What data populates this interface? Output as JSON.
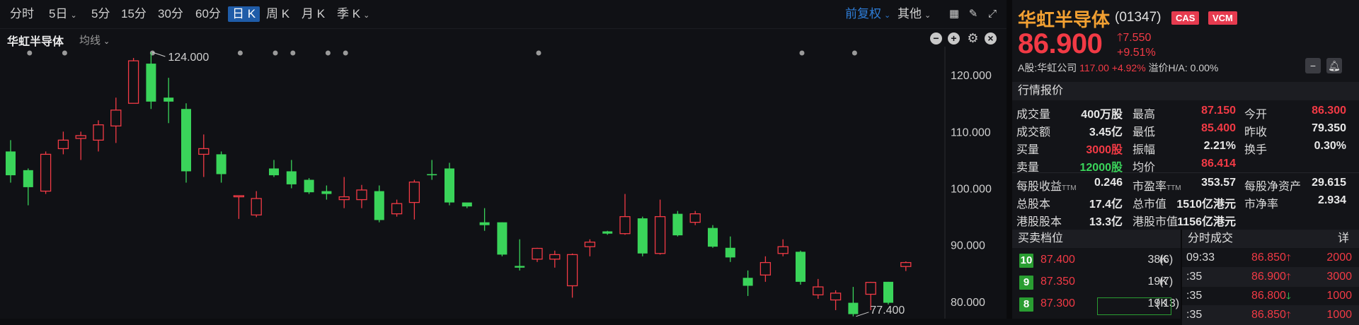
{
  "toolbar": {
    "periods": [
      {
        "label": "分时",
        "caret": false,
        "active": false
      },
      {
        "label": "5日",
        "caret": true,
        "active": false
      },
      {
        "label": "5分",
        "caret": false,
        "active": false
      },
      {
        "label": "15分",
        "caret": false,
        "active": false
      },
      {
        "label": "30分",
        "caret": false,
        "active": false
      },
      {
        "label": "60分",
        "caret": false,
        "active": false
      },
      {
        "label": "日 K",
        "caret": false,
        "active": true
      },
      {
        "label": "周 K",
        "caret": false,
        "active": false
      },
      {
        "label": "月 K",
        "caret": false,
        "active": false
      },
      {
        "label": "季 K",
        "caret": true,
        "active": false
      }
    ],
    "adjust": "前复权",
    "other": "其他",
    "icons": [
      "grid-icon",
      "draw-pen-icon",
      "fullscreen-icon"
    ]
  },
  "subbar": {
    "stock_name": "华虹半导体",
    "ma_label": "均线",
    "icons": [
      "zoom-out-icon",
      "zoom-in-icon",
      "settings-icon",
      "close-icon"
    ]
  },
  "chart_data": {
    "type": "candlestick",
    "y_ticks": [
      "120.000",
      "110.000",
      "100.000",
      "90.000",
      "80.000"
    ],
    "ylim": [
      77,
      125
    ],
    "high_label": "124.000",
    "low_label": "77.400",
    "up_color": "#f23a45",
    "down_color": "#3ad45a",
    "candles": [
      {
        "o": 106.5,
        "c": 102.3,
        "h": 108.5,
        "l": 101.0
      },
      {
        "o": 103.2,
        "c": 100.2,
        "h": 103.5,
        "l": 97.0
      },
      {
        "o": 99.5,
        "c": 106.0,
        "h": 106.5,
        "l": 99.0
      },
      {
        "o": 107.0,
        "c": 108.5,
        "h": 110.0,
        "l": 106.0
      },
      {
        "o": 108.8,
        "c": 109.3,
        "h": 110.0,
        "l": 105.0
      },
      {
        "o": 108.5,
        "c": 111.2,
        "h": 112.0,
        "l": 106.5
      },
      {
        "o": 111.0,
        "c": 113.8,
        "h": 116.0,
        "l": 108.0
      },
      {
        "o": 115.0,
        "c": 122.5,
        "h": 123.0,
        "l": 115.0
      },
      {
        "o": 122.0,
        "c": 115.3,
        "h": 124.0,
        "l": 114.0
      },
      {
        "o": 116.0,
        "c": 115.3,
        "h": 119.5,
        "l": 111.5
      },
      {
        "o": 114.0,
        "c": 103.0,
        "h": 115.0,
        "l": 101.0
      },
      {
        "o": 106.0,
        "c": 107.0,
        "h": 109.5,
        "l": 102.0
      },
      {
        "o": 106.0,
        "c": 102.5,
        "h": 106.5,
        "l": 101.0
      },
      {
        "o": 98.5,
        "c": 98.7,
        "h": 98.7,
        "l": 94.6
      },
      {
        "o": 95.3,
        "c": 98.2,
        "h": 99.5,
        "l": 94.9
      },
      {
        "o": 103.5,
        "c": 102.3,
        "h": 105.0,
        "l": 102.0
      },
      {
        "o": 103.0,
        "c": 100.7,
        "h": 105.0,
        "l": 100.0
      },
      {
        "o": 101.5,
        "c": 99.3,
        "h": 101.8,
        "l": 99.0
      },
      {
        "o": 99.5,
        "c": 99.0,
        "h": 100.5,
        "l": 98.0
      },
      {
        "o": 98.0,
        "c": 98.5,
        "h": 102.0,
        "l": 96.5
      },
      {
        "o": 98.0,
        "c": 99.7,
        "h": 100.6,
        "l": 96.5
      },
      {
        "o": 99.5,
        "c": 94.4,
        "h": 100.5,
        "l": 94.0
      },
      {
        "o": 95.5,
        "c": 97.3,
        "h": 98.0,
        "l": 95.0
      },
      {
        "o": 97.5,
        "c": 101.1,
        "h": 101.5,
        "l": 94.5
      },
      {
        "o": 102.5,
        "c": 102.3,
        "h": 105.0,
        "l": 101.5
      },
      {
        "o": 103.5,
        "c": 97.5,
        "h": 104.5,
        "l": 97.0
      },
      {
        "o": 97.5,
        "c": 96.8,
        "h": 97.0,
        "l": 96.5
      },
      {
        "o": 94.0,
        "c": 93.5,
        "h": 96.5,
        "l": 92.5
      },
      {
        "o": 94.0,
        "c": 88.3,
        "h": 94.0,
        "l": 88.0
      },
      {
        "o": 86.3,
        "c": 86.0,
        "h": 91.0,
        "l": 85.5
      },
      {
        "o": 87.5,
        "c": 89.4,
        "h": 89.5,
        "l": 87.0
      },
      {
        "o": 87.5,
        "c": 88.3,
        "h": 89.0,
        "l": 86.0
      },
      {
        "o": 82.8,
        "c": 88.3,
        "h": 88.5,
        "l": 80.7
      },
      {
        "o": 89.7,
        "c": 90.5,
        "h": 91.0,
        "l": 88.0
      },
      {
        "o": 92.4,
        "c": 92.0,
        "h": 92.5,
        "l": 91.8
      },
      {
        "o": 92.0,
        "c": 95.0,
        "h": 99.0,
        "l": 91.8
      },
      {
        "o": 94.7,
        "c": 88.5,
        "h": 95.0,
        "l": 88.0
      },
      {
        "o": 88.5,
        "c": 95.0,
        "h": 98.0,
        "l": 88.3
      },
      {
        "o": 95.5,
        "c": 91.7,
        "h": 96.0,
        "l": 91.5
      },
      {
        "o": 94.0,
        "c": 95.5,
        "h": 96.0,
        "l": 93.5
      },
      {
        "o": 93.0,
        "c": 89.7,
        "h": 93.5,
        "l": 89.5
      },
      {
        "o": 89.5,
        "c": 87.8,
        "h": 91.5,
        "l": 87.0
      },
      {
        "o": 84.2,
        "c": 82.8,
        "h": 85.5,
        "l": 81.0
      },
      {
        "o": 84.7,
        "c": 86.9,
        "h": 88.0,
        "l": 83.5
      },
      {
        "o": 88.5,
        "c": 89.7,
        "h": 91.0,
        "l": 88.0
      },
      {
        "o": 88.8,
        "c": 83.5,
        "h": 89.0,
        "l": 83.0
      },
      {
        "o": 81.2,
        "c": 82.6,
        "h": 84.0,
        "l": 80.5
      },
      {
        "o": 80.3,
        "c": 81.5,
        "h": 82.0,
        "l": 78.5
      },
      {
        "o": 79.8,
        "c": 77.8,
        "h": 82.6,
        "l": 77.4
      },
      {
        "o": 81.3,
        "c": 83.4,
        "h": 83.5,
        "l": 78.5
      },
      {
        "o": 83.5,
        "c": 79.8,
        "h": 83.5,
        "l": 79.5
      },
      {
        "o": 86.2,
        "c": 86.9,
        "h": 87.1,
        "l": 85.4
      }
    ],
    "event_markers": [
      1,
      3,
      8,
      13,
      15,
      16,
      18,
      19,
      30,
      45,
      48
    ]
  },
  "quote": {
    "title": "华虹半导体",
    "code": "(01347)",
    "badges": [
      "CAS",
      "VCM"
    ],
    "price": "86.900",
    "change": "7.550",
    "change_pct": "+9.51%",
    "a_share_label": "A股:华虹公司",
    "a_share_price": "117.00",
    "a_share_pct": "+4.92%",
    "premium": "溢价H/A: 0.00%",
    "header_icons": [
      "minus-icon",
      "bell-icon"
    ]
  },
  "market": {
    "section_title": "行情报价",
    "grid": [
      [
        {
          "label": "成交量",
          "value": "400万股",
          "color": "#e8e8e8"
        },
        {
          "label": "最高",
          "value": "87.150",
          "color": "#f23a45"
        },
        {
          "label": "今开",
          "value": "86.300",
          "color": "#f23a45"
        }
      ],
      [
        {
          "label": "成交额",
          "value": "3.45亿",
          "color": "#e8e8e8"
        },
        {
          "label": "最低",
          "value": "85.400",
          "color": "#f23a45"
        },
        {
          "label": "昨收",
          "value": "79.350",
          "color": "#e8e8e8"
        }
      ],
      [
        {
          "label": "买量",
          "value": "3000股",
          "color": "#f23a45"
        },
        {
          "label": "振幅",
          "value": "2.21%",
          "color": "#e8e8e8"
        },
        {
          "label": "换手",
          "value": "0.30%",
          "color": "#e8e8e8"
        }
      ],
      [
        {
          "label": "卖量",
          "value": "12000股",
          "color": "#3ad45a"
        },
        {
          "label": "均价",
          "value": "86.414",
          "color": "#f23a45"
        },
        {
          "label": "",
          "value": "",
          "color": "#e8e8e8"
        }
      ]
    ],
    "grid2": [
      [
        {
          "label": "每股收益",
          "sub": "TTM",
          "value": "0.246"
        },
        {
          "label": "市盈率",
          "sub": "TTM",
          "value": "353.57"
        },
        {
          "label": "每股净资产",
          "sub": "",
          "value": "29.615"
        }
      ],
      [
        {
          "label": "总股本",
          "sub": "",
          "value": "17.4亿"
        },
        {
          "label": "总市值",
          "sub": "",
          "value": "1510亿港元"
        },
        {
          "label": "市净率",
          "sub": "",
          "value": "2.934"
        }
      ],
      [
        {
          "label": "港股股本",
          "sub": "",
          "value": "13.3亿"
        },
        {
          "label": "港股市值",
          "sub": "",
          "value": "1156亿港元"
        },
        {
          "label": "",
          "sub": "",
          "value": ""
        }
      ]
    ]
  },
  "orderbook": {
    "title": "买卖档位",
    "rows": [
      {
        "level": "10",
        "price": "87.400",
        "vol": "38K",
        "count": "6)"
      },
      {
        "level": "9",
        "price": "87.350",
        "vol": "19K",
        "count": "7)"
      },
      {
        "level": "8",
        "price": "87.300",
        "vol": "19K",
        "count": "13)"
      }
    ]
  },
  "ticks": {
    "title": "分时成交",
    "detail": "详",
    "rows": [
      {
        "time": "09:33",
        "price": "86.850",
        "dir": "up",
        "vol": "2000"
      },
      {
        "time": ":35",
        "price": "86.900",
        "dir": "up",
        "vol": "3000"
      },
      {
        "time": ":35",
        "price": "86.800",
        "dir": "down",
        "vol": "1000"
      },
      {
        "time": ":35",
        "price": "86.850",
        "dir": "up",
        "vol": "1000"
      }
    ]
  }
}
